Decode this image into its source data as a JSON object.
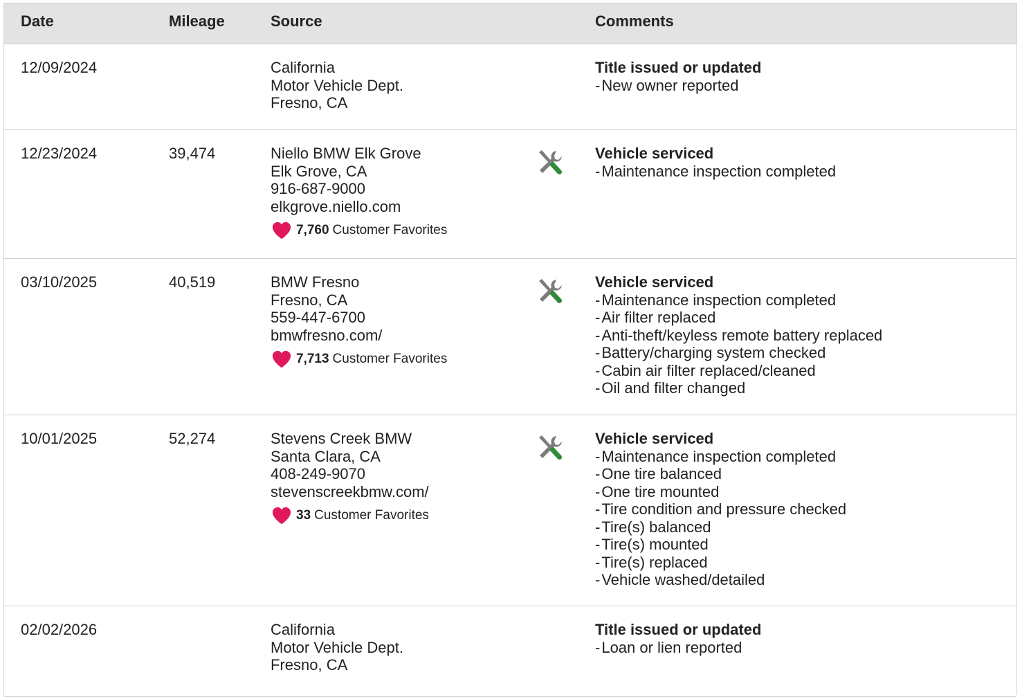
{
  "header": {
    "date": "Date",
    "mileage": "Mileage",
    "source": "Source",
    "comments": "Comments"
  },
  "favorites_label": "Customer Favorites",
  "rows": [
    {
      "date": "12/09/2024",
      "mileage": "",
      "source": [
        "California",
        "Motor Vehicle Dept.",
        "Fresno, CA"
      ],
      "favorites": null,
      "icon": null,
      "comment_title": "Title issued or updated",
      "comments": [
        "New owner reported"
      ]
    },
    {
      "date": "12/23/2024",
      "mileage": "39,474",
      "source": [
        "Niello BMW Elk Grove",
        "Elk Grove, CA",
        "916-687-9000",
        "elkgrove.niello.com"
      ],
      "favorites": "7,760",
      "icon": "service-tools-icon",
      "comment_title": "Vehicle serviced",
      "comments": [
        "Maintenance inspection completed"
      ]
    },
    {
      "date": "03/10/2025",
      "mileage": "40,519",
      "source": [
        "BMW Fresno",
        "Fresno, CA",
        "559-447-6700",
        "bmwfresno.com/"
      ],
      "favorites": "7,713",
      "icon": "service-tools-icon",
      "comment_title": "Vehicle serviced",
      "comments": [
        "Maintenance inspection completed",
        "Air filter replaced",
        "Anti-theft/keyless remote battery replaced",
        "Battery/charging system checked",
        "Cabin air filter replaced/cleaned",
        "Oil and filter changed"
      ]
    },
    {
      "date": "10/01/2025",
      "mileage": "52,274",
      "source": [
        "Stevens Creek BMW",
        "Santa Clara, CA",
        "408-249-9070",
        "stevenscreekbmw.com/"
      ],
      "favorites": "33",
      "icon": "service-tools-icon",
      "comment_title": "Vehicle serviced",
      "comments": [
        "Maintenance inspection completed",
        "One tire balanced",
        "One tire mounted",
        "Tire condition and pressure checked",
        "Tire(s) balanced",
        "Tire(s) mounted",
        "Tire(s) replaced",
        "Vehicle washed/detailed"
      ]
    },
    {
      "date": "02/02/2026",
      "mileage": "",
      "source": [
        "California",
        "Motor Vehicle Dept.",
        "Fresno, CA"
      ],
      "favorites": null,
      "icon": null,
      "comment_title": "Title issued or updated",
      "comments": [
        "Loan or lien reported"
      ]
    }
  ],
  "colors": {
    "header_bg": "#e3e3e3",
    "heart": "#e0195e",
    "wrench_gray": "#7c7c7c",
    "screwdriver_green": "#2f8a3a",
    "border": "#cfcfcf"
  }
}
